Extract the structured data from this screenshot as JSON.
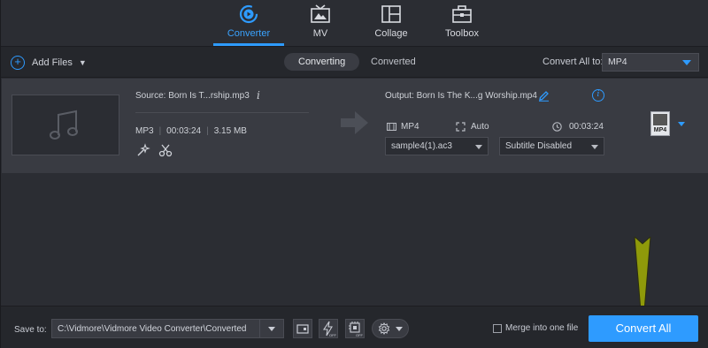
{
  "nav": {
    "tabs": [
      {
        "label": "Converter",
        "icon": "converter-icon",
        "active": true
      },
      {
        "label": "MV",
        "icon": "mv-icon",
        "active": false
      },
      {
        "label": "Collage",
        "icon": "collage-icon",
        "active": false
      },
      {
        "label": "Toolbox",
        "icon": "toolbox-icon",
        "active": false
      }
    ]
  },
  "toolbar": {
    "add_files": "Add Files",
    "tab_converting": "Converting",
    "tab_converted": "Converted",
    "convert_all_to_label": "Convert All to:",
    "convert_all_to_value": "MP4"
  },
  "file": {
    "source": "Source: Born Is T...rship.mp3",
    "format": "MP3",
    "duration": "00:03:24",
    "size": "3.15 MB",
    "output": "Output: Born Is The K...g Worship.mp4",
    "out_format": "MP4",
    "out_resolution": "Auto",
    "out_duration": "00:03:24",
    "audio_track": "sample4(1).ac3",
    "subtitle": "Subtitle Disabled",
    "format_badge": "MP4"
  },
  "bottom": {
    "save_to_label": "Save to:",
    "save_path": "C:\\Vidmore\\Vidmore Video Converter\\Converted",
    "merge_label": "Merge into one file",
    "convert_all_button": "Convert All"
  },
  "colors": {
    "accent": "#2e9bff",
    "background": "#2b2d33",
    "row": "#393b42",
    "annotation_arrow": "#8f9a0a"
  }
}
